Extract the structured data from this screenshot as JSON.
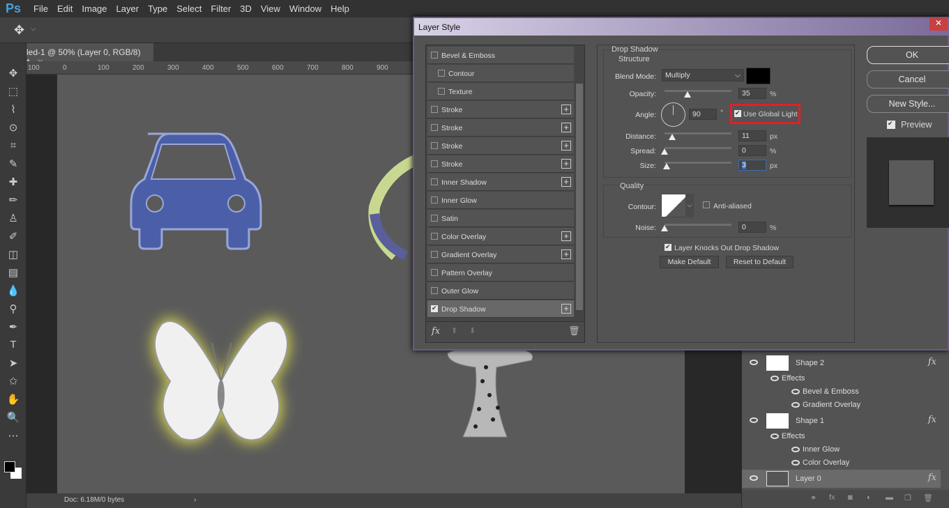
{
  "app": {
    "logo": "Ps",
    "menu": [
      "File",
      "Edit",
      "Image",
      "Layer",
      "Type",
      "Select",
      "Filter",
      "3D",
      "View",
      "Window",
      "Help"
    ]
  },
  "document": {
    "tab_title": "led-1 @ 50% (Layer 0, RGB/8) *",
    "ruler_ticks": [
      "100",
      "0",
      "100",
      "200",
      "300",
      "400",
      "500",
      "600",
      "700",
      "800",
      "900"
    ],
    "status": "Doc: 6.18M/0 bytes"
  },
  "tools": [
    "move-icon",
    "marquee-icon",
    "lasso-icon",
    "quick-select-icon",
    "crop-icon",
    "eyedropper-icon",
    "healing-icon",
    "brush-icon",
    "stamp-icon",
    "history-brush-icon",
    "eraser-icon",
    "gradient-icon",
    "blur-icon",
    "dodge-icon",
    "pen-icon",
    "type-icon",
    "path-select-icon",
    "shape-icon",
    "hand-icon",
    "zoom-icon",
    "more-icon"
  ],
  "layers": [
    {
      "name": "Shape 2",
      "effects_label": "Effects",
      "effects": [
        "Bevel & Emboss",
        "Gradient Overlay"
      ]
    },
    {
      "name": "Shape 1",
      "effects_label": "Effects",
      "effects": [
        "Inner Glow",
        "Color Overlay"
      ]
    },
    {
      "name": "Layer 0"
    }
  ],
  "dialog": {
    "title": "Layer Style",
    "styles": [
      {
        "label": "Bevel & Emboss",
        "checked": false,
        "plus": false,
        "indent": false
      },
      {
        "label": "Contour",
        "checked": false,
        "plus": false,
        "indent": true
      },
      {
        "label": "Texture",
        "checked": false,
        "plus": false,
        "indent": true
      },
      {
        "label": "Stroke",
        "checked": false,
        "plus": true
      },
      {
        "label": "Stroke",
        "checked": false,
        "plus": true
      },
      {
        "label": "Stroke",
        "checked": false,
        "plus": true
      },
      {
        "label": "Stroke",
        "checked": false,
        "plus": true
      },
      {
        "label": "Inner Shadow",
        "checked": false,
        "plus": true
      },
      {
        "label": "Inner Glow",
        "checked": false,
        "plus": false
      },
      {
        "label": "Satin",
        "checked": false,
        "plus": false
      },
      {
        "label": "Color Overlay",
        "checked": false,
        "plus": true
      },
      {
        "label": "Gradient Overlay",
        "checked": false,
        "plus": true
      },
      {
        "label": "Pattern Overlay",
        "checked": false,
        "plus": false
      },
      {
        "label": "Outer Glow",
        "checked": false,
        "plus": false
      },
      {
        "label": "Drop Shadow",
        "checked": true,
        "plus": true,
        "selected": true
      }
    ],
    "section": "Drop Shadow",
    "structure": "Structure",
    "blend_mode_label": "Blend Mode:",
    "blend_mode": "Multiply",
    "shadow_color": "#000000",
    "opacity_label": "Opacity:",
    "opacity": "35",
    "opacity_unit": "%",
    "angle_label": "Angle:",
    "angle": "90",
    "angle_unit": "°",
    "global_light_label": "Use Global Light",
    "global_light": true,
    "highlight_color": "#e0202a",
    "distance_label": "Distance:",
    "distance": "11",
    "distance_unit": "px",
    "spread_label": "Spread:",
    "spread": "0",
    "spread_unit": "%",
    "size_label": "Size:",
    "size": "3",
    "size_unit": "px",
    "quality": "Quality",
    "contour_label": "Contour:",
    "anti_aliased_label": "Anti-aliased",
    "anti_aliased": false,
    "noise_label": "Noise:",
    "noise": "0",
    "noise_unit": "%",
    "knockout_label": "Layer Knocks Out Drop Shadow",
    "knockout": true,
    "make_default": "Make Default",
    "reset_default": "Reset to Default",
    "ok": "OK",
    "cancel": "Cancel",
    "new_style": "New Style...",
    "preview_label": "Preview",
    "preview": true
  }
}
